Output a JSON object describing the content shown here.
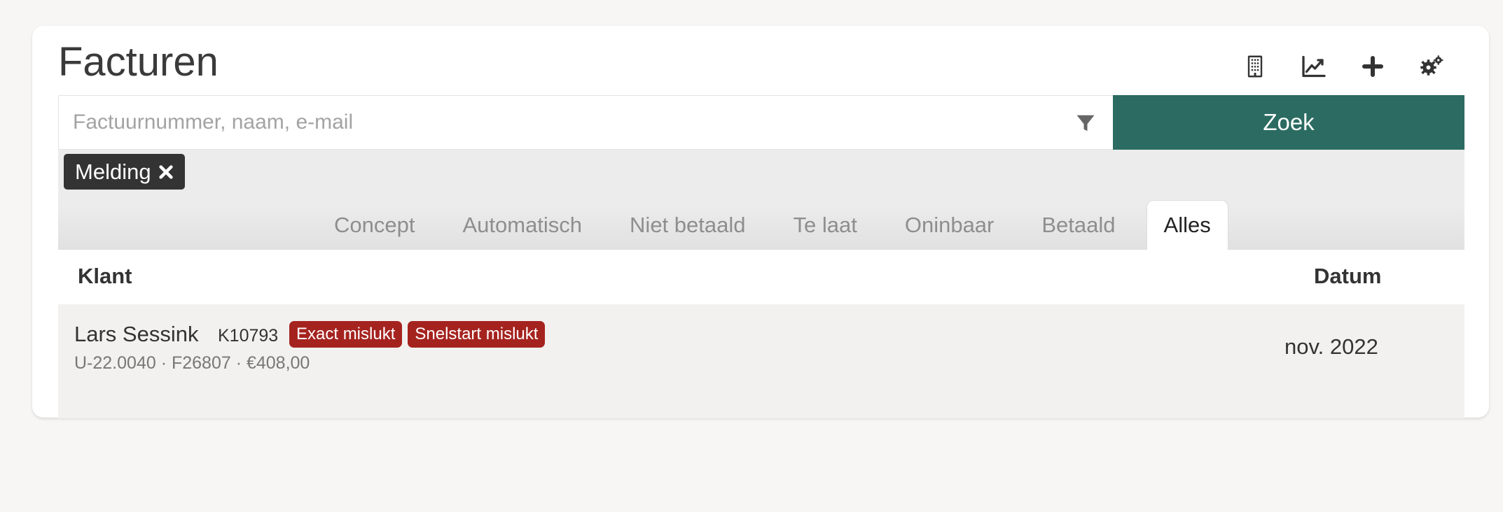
{
  "header": {
    "title": "Facturen",
    "actions": [
      {
        "icon": "building-icon"
      },
      {
        "icon": "chart-line-icon"
      },
      {
        "icon": "plus-icon"
      },
      {
        "icon": "cogs-icon"
      }
    ]
  },
  "search": {
    "placeholder": "Factuurnummer, naam, e-mail",
    "value": "",
    "button_label": "Zoek"
  },
  "filter_chip": {
    "label": "Melding"
  },
  "tabs": [
    {
      "label": "Concept"
    },
    {
      "label": "Automatisch"
    },
    {
      "label": "Niet betaald"
    },
    {
      "label": "Te laat"
    },
    {
      "label": "Oninbaar"
    },
    {
      "label": "Betaald"
    },
    {
      "label": "Alles",
      "active": true
    }
  ],
  "table": {
    "headers": {
      "klant": "Klant",
      "datum": "Datum"
    },
    "rows": [
      {
        "name": "Lars Sessink",
        "code": "K10793",
        "badges": [
          "Exact mislukt",
          "Snelstart mislukt"
        ],
        "sub": "U-22.0040 · F26807 · €408,00",
        "date": "nov. 2022"
      }
    ]
  },
  "colors": {
    "accent": "#2b6b61",
    "badge": "#a5231f",
    "chip": "#333333"
  }
}
